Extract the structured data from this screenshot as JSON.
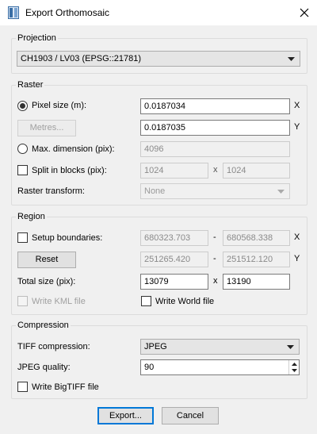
{
  "window": {
    "title": "Export Orthomosaic",
    "icon": "app-document-icon"
  },
  "projection": {
    "group_title": "Projection",
    "selected": "CH1903 / LV03 (EPSG::21781)"
  },
  "raster": {
    "group_title": "Raster",
    "pixel_size_label": "Pixel size (m):",
    "pixel_size_x": "0.0187034",
    "pixel_size_y": "0.0187035",
    "x_axis": "X",
    "y_axis": "Y",
    "metres_button": "Metres...",
    "max_dimension_label": "Max. dimension (pix):",
    "max_dimension_value": "4096",
    "split_blocks_label": "Split in blocks (pix):",
    "block_w": "1024",
    "block_h": "1024",
    "by": "x",
    "raster_transform_label": "Raster transform:",
    "raster_transform_value": "None"
  },
  "region": {
    "group_title": "Region",
    "setup_boundaries_label": "Setup boundaries:",
    "x_min": "680323.703",
    "x_max": "680568.338",
    "y_min": "251265.420",
    "y_max": "251512.120",
    "dash": "-",
    "x_axis": "X",
    "y_axis": "Y",
    "reset_button": "Reset",
    "total_size_label": "Total size (pix):",
    "total_w": "13079",
    "total_h": "13190",
    "by": "x",
    "write_kml_label": "Write KML file",
    "write_world_label": "Write World file"
  },
  "compression": {
    "group_title": "Compression",
    "tiff_label": "TIFF compression:",
    "tiff_value": "JPEG",
    "jpeg_quality_label": "JPEG quality:",
    "jpeg_quality_value": "90",
    "bigtiff_label": "Write BigTIFF file"
  },
  "buttons": {
    "export": "Export...",
    "cancel": "Cancel"
  },
  "colors": {
    "default_button_border": "#0078d7",
    "disabled_text": "#a0a0a0"
  }
}
